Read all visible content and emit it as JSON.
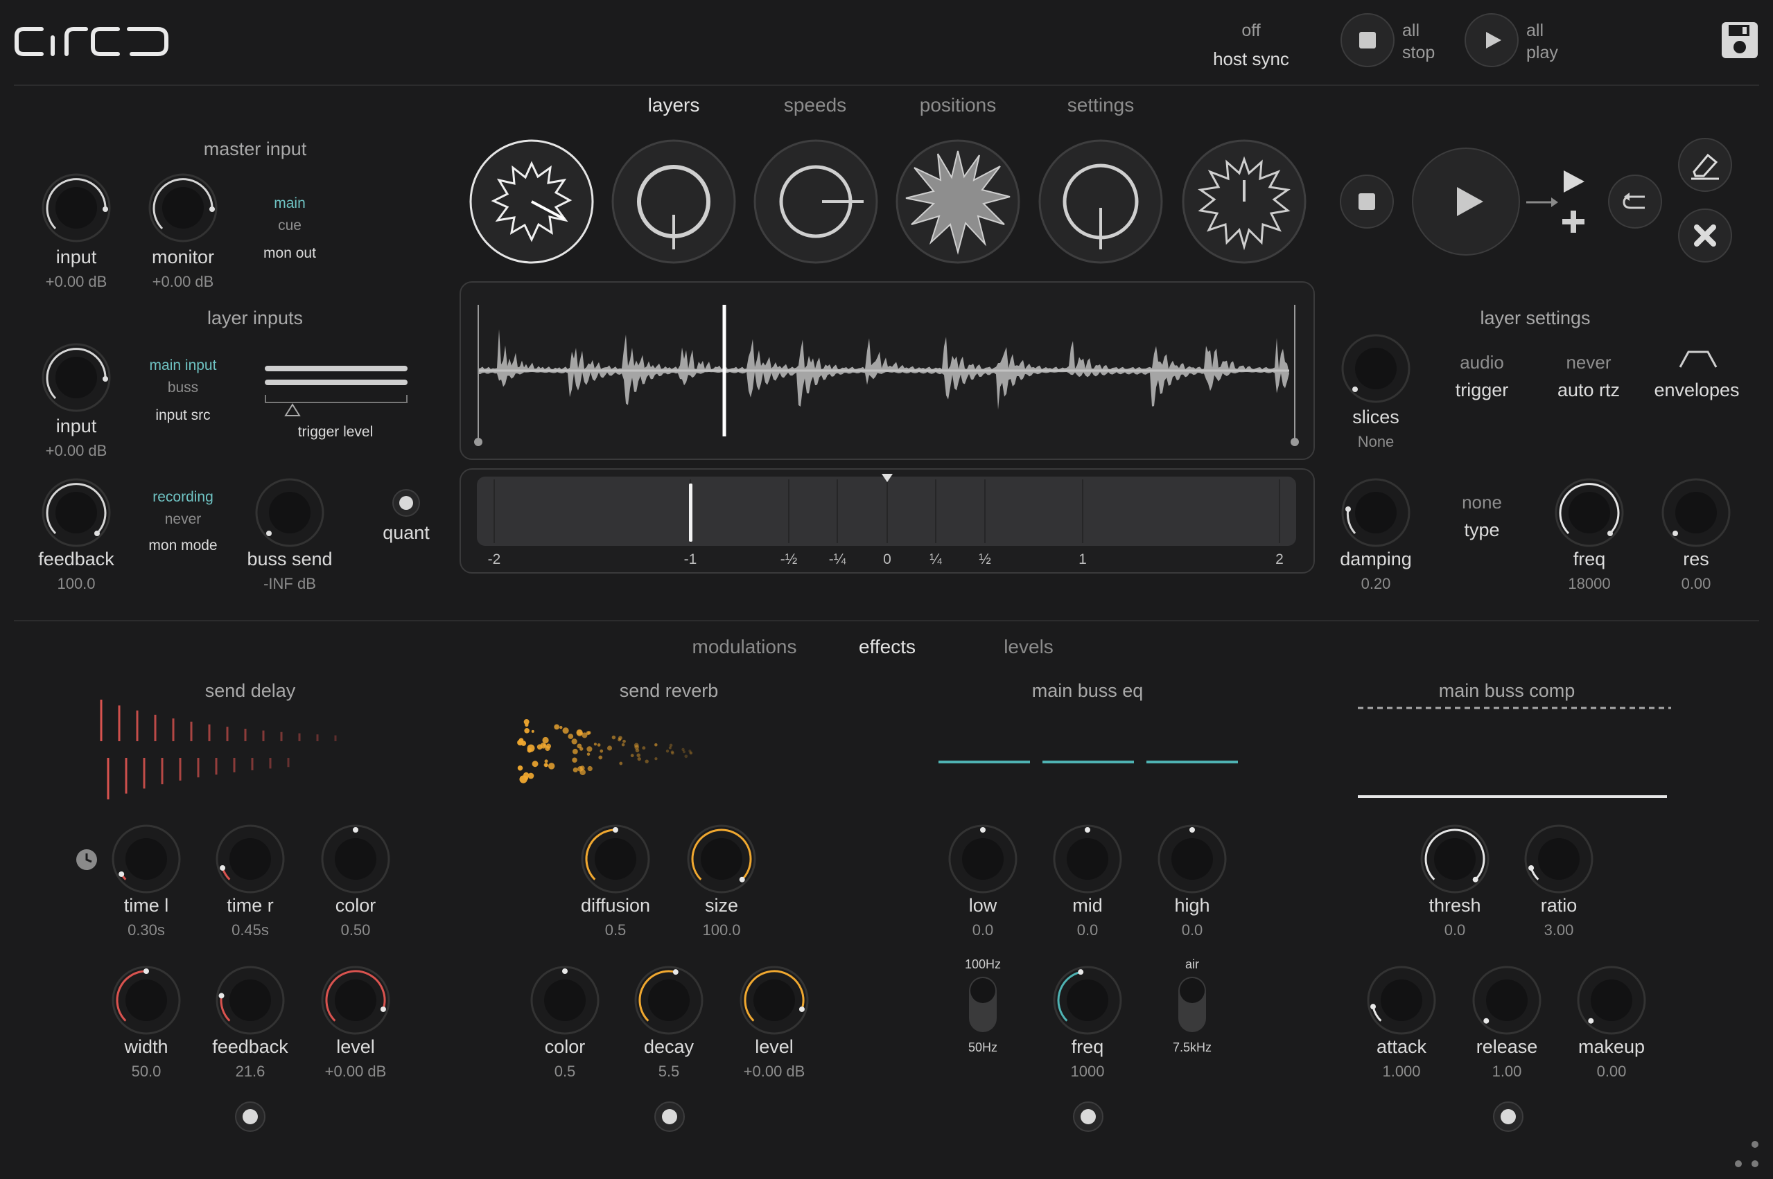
{
  "app": {
    "logo": "circo"
  },
  "top": {
    "host_sync_state": "off",
    "host_sync_label": "host sync",
    "all_stop": [
      "all",
      "stop"
    ],
    "all_play": [
      "all",
      "play"
    ]
  },
  "tabs_top": [
    "layers",
    "speeds",
    "positions",
    "settings"
  ],
  "master_input": {
    "title": "master input",
    "input": {
      "label": "input",
      "value": "+0.00 dB"
    },
    "monitor": {
      "label": "monitor",
      "value": "+0.00 dB"
    },
    "routing": [
      "main",
      "cue"
    ],
    "routing_label": "mon out"
  },
  "layer_inputs": {
    "title": "layer inputs",
    "input": {
      "label": "input",
      "value": "+0.00 dB"
    },
    "source": [
      "main input",
      "buss"
    ],
    "source_label": "input src",
    "trigger_label": "trigger level",
    "feedback": {
      "label": "feedback",
      "value": "100.0"
    },
    "mode": [
      "recording",
      "never"
    ],
    "mode_label": "mon mode",
    "buss_send": {
      "label": "buss send",
      "value": "-INF dB"
    },
    "quant_label": "quant"
  },
  "speed_axis": [
    "-2",
    "-1",
    "-½",
    "-¼",
    "0",
    "¼",
    "½",
    "1",
    "2"
  ],
  "layer_settings": {
    "title": "layer settings",
    "slices": {
      "label": "slices",
      "value": "None"
    },
    "trigger": {
      "state": "audio",
      "label": "trigger"
    },
    "auto_rtz": {
      "state": "never",
      "label": "auto rtz"
    },
    "envelopes_label": "envelopes",
    "damping": {
      "label": "damping",
      "value": "0.20"
    },
    "type": {
      "state": "none",
      "label": "type"
    },
    "freq": {
      "label": "freq",
      "value": "18000"
    },
    "res": {
      "label": "res",
      "value": "0.00"
    }
  },
  "tabs_bottom": [
    "modulations",
    "effects",
    "levels"
  ],
  "send_delay": {
    "title": "send delay",
    "knobs": [
      {
        "label": "time l",
        "value": "0.30s"
      },
      {
        "label": "time r",
        "value": "0.45s"
      },
      {
        "label": "color",
        "value": "0.50"
      },
      {
        "label": "width",
        "value": "50.0"
      },
      {
        "label": "feedback",
        "value": "21.6"
      },
      {
        "label": "level",
        "value": "+0.00 dB"
      }
    ]
  },
  "send_reverb": {
    "title": "send reverb",
    "knobs": [
      {
        "label": "diffusion",
        "value": "0.5"
      },
      {
        "label": "size",
        "value": "100.0"
      },
      {
        "label": "color",
        "value": "0.5"
      },
      {
        "label": "decay",
        "value": "5.5"
      },
      {
        "label": "level",
        "value": "+0.00 dB"
      }
    ]
  },
  "main_buss_eq": {
    "title": "main buss eq",
    "knobs": [
      {
        "label": "low",
        "value": "0.0"
      },
      {
        "label": "mid",
        "value": "0.0"
      },
      {
        "label": "high",
        "value": "0.0"
      },
      {
        "label": "freq",
        "value": "1000"
      }
    ],
    "low_switch": {
      "top": "100Hz",
      "bottom": "50Hz"
    },
    "high_switch": {
      "top": "air",
      "bottom": "7.5kHz"
    }
  },
  "main_buss_comp": {
    "title": "main buss comp",
    "knobs": [
      {
        "label": "thresh",
        "value": "0.0"
      },
      {
        "label": "ratio",
        "value": "3.00"
      },
      {
        "label": "attack",
        "value": "1.000"
      },
      {
        "label": "release",
        "value": "1.00"
      },
      {
        "label": "makeup",
        "value": "0.00"
      }
    ]
  },
  "colors": {
    "bg": "#1b1b1c",
    "delay": "#d9534f",
    "reverb": "#f0a830",
    "eq": "#4fb3b3",
    "text": "#dcdcdc"
  }
}
